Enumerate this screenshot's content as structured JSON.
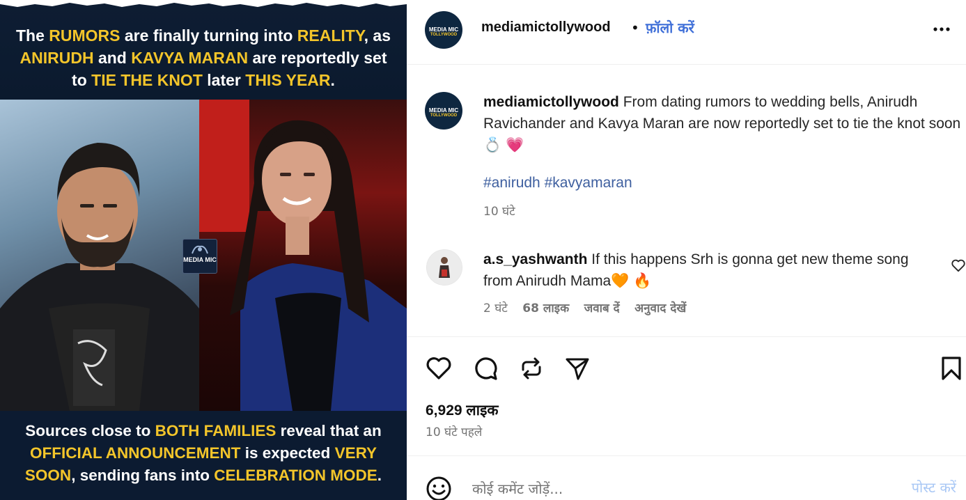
{
  "image": {
    "top_text": [
      [
        {
          "t": "The ",
          "c": "w"
        },
        {
          "t": "RUMORS",
          "c": "y"
        },
        {
          "t": " are finally turning into ",
          "c": "w"
        },
        {
          "t": "REALITY",
          "c": "y"
        },
        {
          "t": ", as",
          "c": "w"
        }
      ],
      [
        {
          "t": "ANIRUDH",
          "c": "y"
        },
        {
          "t": " and ",
          "c": "w"
        },
        {
          "t": "KAVYA MARAN",
          "c": "y"
        },
        {
          "t": " are reportedly set",
          "c": "w"
        }
      ],
      [
        {
          "t": "to ",
          "c": "w"
        },
        {
          "t": "TIE THE KNOT",
          "c": "y"
        },
        {
          "t": " later ",
          "c": "w"
        },
        {
          "t": "THIS YEAR",
          "c": "y"
        },
        {
          "t": ".",
          "c": "w"
        }
      ]
    ],
    "bottom_text": [
      [
        {
          "t": "Sources close to ",
          "c": "w"
        },
        {
          "t": "BOTH FAMILIES",
          "c": "y"
        },
        {
          "t": " reveal that an",
          "c": "w"
        }
      ],
      [
        {
          "t": "OFFICIAL ANNOUNCEMENT",
          "c": "y"
        },
        {
          "t": " is expected ",
          "c": "w"
        },
        {
          "t": "VERY",
          "c": "y"
        }
      ],
      [
        {
          "t": "SOON",
          "c": "y"
        },
        {
          "t": ", sending fans into ",
          "c": "w"
        },
        {
          "t": "CELEBRATION MODE",
          "c": "y"
        },
        {
          "t": ".",
          "c": "w"
        }
      ]
    ],
    "watermark": "MEDIA MIC",
    "accent_yellow": "#f3c52a",
    "navy": "#0c1b31"
  },
  "header": {
    "avatar_line1": "MEDIA MIC",
    "avatar_line2": "TOLLYWOOD",
    "username": "mediamictollywood",
    "separator": "•",
    "follow_label": "फ़ॉलो करें",
    "more_icon": "more-horizontal-icon"
  },
  "caption": {
    "username": "mediamictollywood",
    "text": "From dating rumors to wedding bells, Anirudh Ravichander and Kavya Maran are now reportedly set to tie the knot soon 💍 💗",
    "hashtags": "#anirudh #kavyamaran",
    "time": "10 घंटे"
  },
  "comment": {
    "username": "a.s_yashwanth",
    "text": "If this happens Srh is gonna get new theme song from Anirudh Mama🧡 🔥",
    "time": "2 घंटे",
    "likes": "68 लाइक",
    "reply": "जवाब दें",
    "translate": "अनुवाद देखें"
  },
  "actions": {
    "icons": [
      "heart-icon",
      "comment-icon",
      "repost-icon",
      "share-icon",
      "bookmark-icon"
    ],
    "likes": "6,929 लाइक",
    "posted": "10 घंटे पहले"
  },
  "comment_bar": {
    "placeholder": "कोई कमेंट जोड़ें...",
    "post_label": "पोस्ट करें",
    "post_color": "#a8c7f5"
  }
}
